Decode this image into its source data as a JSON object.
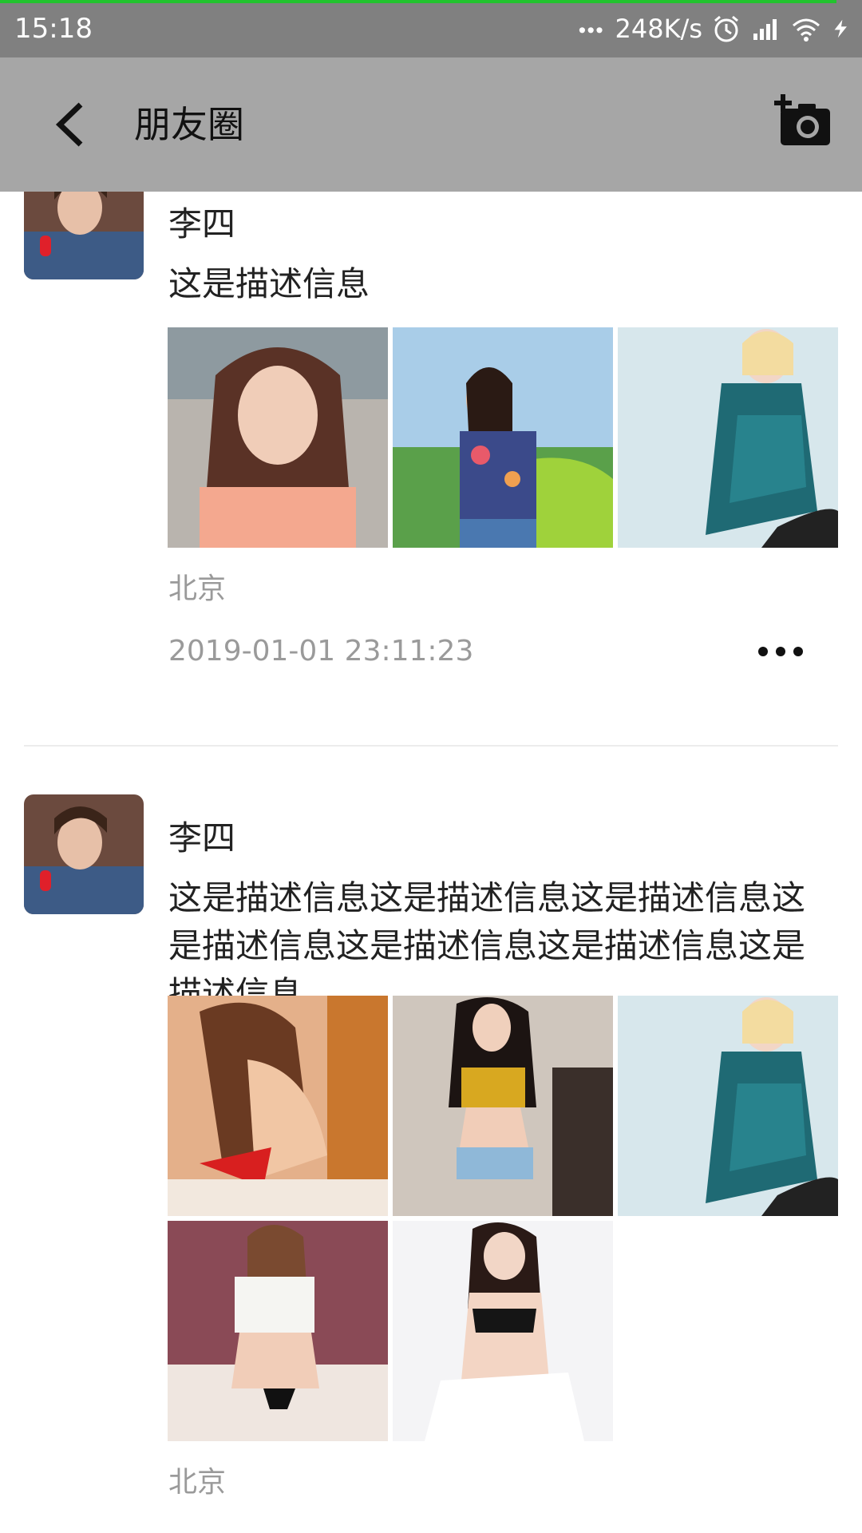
{
  "status_bar": {
    "time": "15:18",
    "network_speed": "248K/s",
    "icons": [
      "more-dots-icon",
      "alarm-icon",
      "signal-icon",
      "wifi-icon",
      "charging-icon"
    ],
    "progress": 0.97,
    "progress_color": "#22c32e"
  },
  "header": {
    "back_icon": "back-arrow-icon",
    "title": "朋友圈",
    "camera_icon": "add-photo-camera-icon"
  },
  "posts": [
    {
      "author": "李四",
      "description": "这是描述信息",
      "photos": [
        "photo-1",
        "photo-2",
        "photo-3"
      ],
      "location": "北京",
      "time": "2019-01-01 23:11:23",
      "more_icon": "more-options-icon"
    },
    {
      "author": "李四",
      "description": "这是描述信息这是描述信息这是描述信息这是描述信息这是描述信息这是描述信息这是描述信息",
      "photos": [
        "photo-1",
        "photo-2",
        "photo-3",
        "photo-4",
        "photo-5"
      ],
      "location": "北京"
    }
  ],
  "colors": {
    "header_background": "#a6a6a6",
    "status_background": "#808080",
    "secondary_text": "#9a9a9a"
  }
}
